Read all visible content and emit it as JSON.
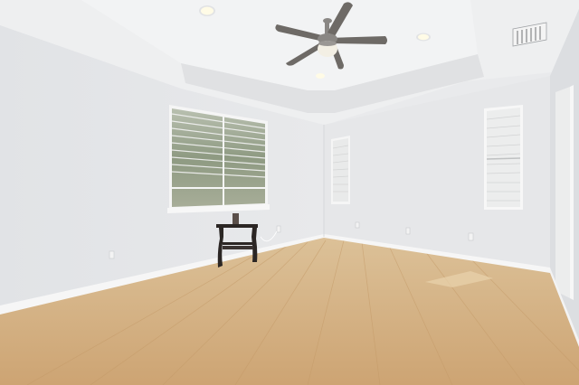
{
  "scene": {
    "description_free": true,
    "colors": {
      "wall_left": "#e4e6e8",
      "wall_back": "#e7e8ea",
      "wall_right": "#dfe1e3",
      "ceiling": "#eeeff0",
      "tray_face": "#e2e3e5",
      "baseboard": "#f6f6f6",
      "floor_light": "#d9b98c",
      "floor_dark": "#c79e6c",
      "fan_blade": "#6e6a66",
      "fan_metal": "#8a8784",
      "fan_light": "#f3efe4",
      "blind": "#f0f1f1",
      "window_view": "#9fa892",
      "table": "#2b2624"
    },
    "icons": [
      "ceiling-fan-icon",
      "recessed-light-icon",
      "air-vent-icon",
      "power-outlet-icon"
    ]
  }
}
